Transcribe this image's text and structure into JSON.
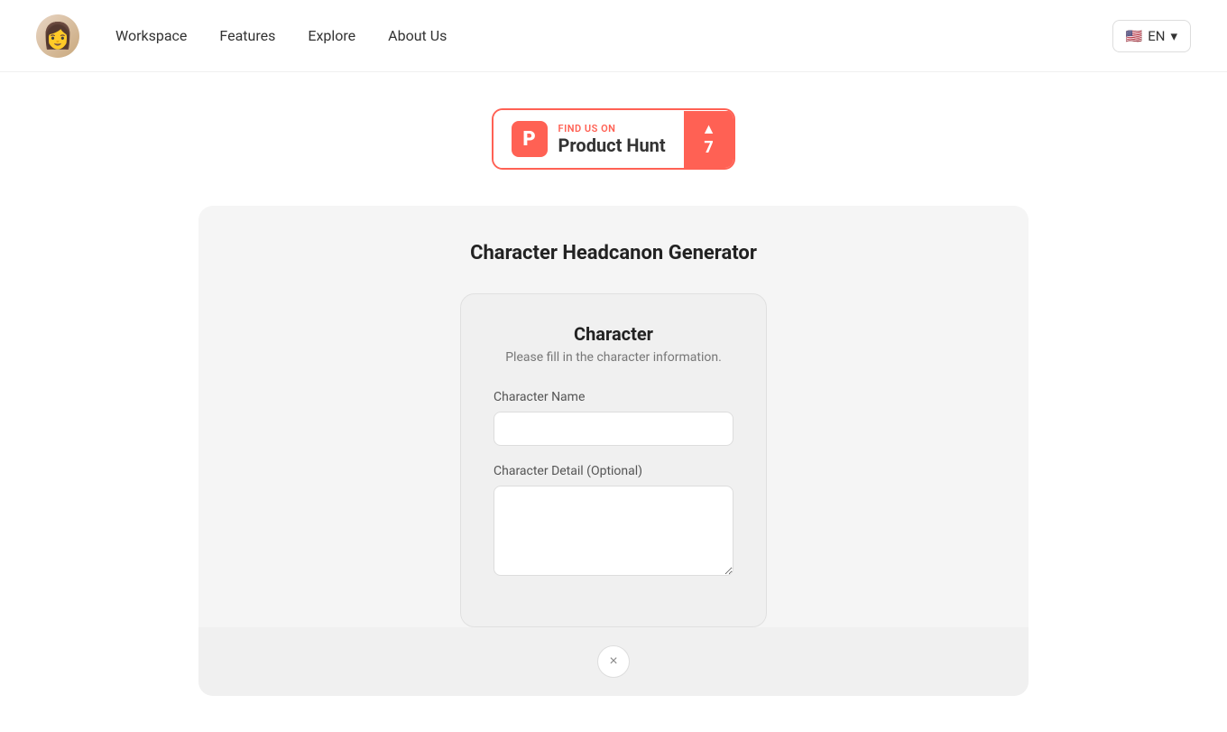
{
  "header": {
    "logo_emoji": "👩",
    "nav": {
      "workspace": "Workspace",
      "features": "Features",
      "explore": "Explore",
      "about_us": "About Us"
    },
    "lang": {
      "flag": "🇺🇸",
      "code": "EN"
    }
  },
  "product_hunt": {
    "find_us_label": "FIND US ON",
    "name": "Product Hunt",
    "icon_letter": "P",
    "triangle": "▲",
    "vote_count": "7"
  },
  "card": {
    "title": "Character Headcanon Generator",
    "form": {
      "title": "Character",
      "subtitle": "Please fill in the character information.",
      "character_name_label": "Character Name",
      "character_name_placeholder": "",
      "character_detail_label": "Character Detail (Optional)",
      "character_detail_placeholder": ""
    },
    "close_icon": "×"
  }
}
